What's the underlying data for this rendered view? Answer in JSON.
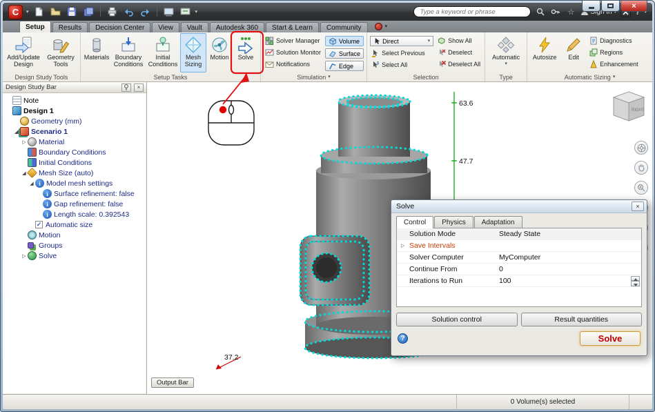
{
  "icons": {
    "chevron_down": "▾",
    "close": "×",
    "check": "✓",
    "star": "☆",
    "help": "?",
    "info": "i",
    "collapsed": "▷",
    "expanded": "◢",
    "logo": "C"
  },
  "titlebar": {
    "search_placeholder": "Type a keyword or phrase",
    "sign_in": "Sign In"
  },
  "tabs": {
    "items": [
      "Setup",
      "Results",
      "Decision Center",
      "View",
      "Vault",
      "Autodesk 360",
      "Start & Learn",
      "Community"
    ]
  },
  "ribbon": {
    "design_study_tools": {
      "label": "Design Study Tools",
      "add_update_design": "Add/Update Design",
      "geometry_tools": "Geometry Tools"
    },
    "setup_tasks": {
      "label": "Setup Tasks",
      "materials": "Materials",
      "boundary_conditions": "Boundary Conditions",
      "initial_conditions": "Initial Conditions",
      "mesh_sizing": "Mesh Sizing",
      "motion": "Motion",
      "solve": "Solve"
    },
    "simulation": {
      "label": "Simulation",
      "solver_manager": "Solver Manager",
      "solution_monitor": "Solution Monitor",
      "notifications": "Notifications",
      "volume": "Volume",
      "surface": "Surface",
      "edge": "Edge"
    },
    "selection": {
      "label": "Selection",
      "direct": "Direct",
      "select_previous": "Select Previous",
      "select_all": "Select All",
      "show_all": "Show All",
      "deselect": "Deselect",
      "deselect_all": "Deselect All"
    },
    "type": {
      "label": "Type",
      "automatic": "Automatic"
    },
    "automatic_sizing": {
      "label": "Automatic Sizing",
      "autosize": "Autosize",
      "edit": "Edit",
      "diagnostics": "Diagnostics",
      "regions": "Regions",
      "enhancement": "Enhancement"
    }
  },
  "design_study_bar": {
    "title": "Design Study Bar",
    "items": [
      {
        "label": "Note"
      },
      {
        "label": "Design 1"
      },
      {
        "label": "Geometry (mm)"
      },
      {
        "label": "Scenario 1"
      },
      {
        "label": "Material"
      },
      {
        "label": "Boundary Conditions"
      },
      {
        "label": "Initial Conditions"
      },
      {
        "label": "Mesh Size (auto)"
      },
      {
        "label": "Model mesh settings"
      },
      {
        "label": "Surface refinement: false"
      },
      {
        "label": "Gap refinement: false"
      },
      {
        "label": "Length scale: 0.392543"
      },
      {
        "label": "Automatic size"
      },
      {
        "label": "Motion"
      },
      {
        "label": "Groups"
      },
      {
        "label": "Solve"
      }
    ]
  },
  "viewport": {
    "dim_top": "63.6",
    "dim_mid": "47.7",
    "dim_bottom": "37.2",
    "view_cube_face": "RIGHT",
    "output_bar": "Output Bar"
  },
  "solve_dialog": {
    "title": "Solve",
    "tabs": [
      "Control",
      "Physics",
      "Adaptation"
    ],
    "rows": [
      {
        "label": "Solution Mode",
        "value": "Steady State"
      },
      {
        "label": "Save Intervals",
        "value": ""
      },
      {
        "label": "Solver Computer",
        "value": "MyComputer"
      },
      {
        "label": "Continue From",
        "value": "0"
      },
      {
        "label": "Iterations to Run",
        "value": "100"
      }
    ],
    "solution_control": "Solution control",
    "result_quantities": "Result quantities",
    "solve_button": "Solve"
  },
  "statusbar": {
    "selection": "0 Volume(s) selected"
  }
}
